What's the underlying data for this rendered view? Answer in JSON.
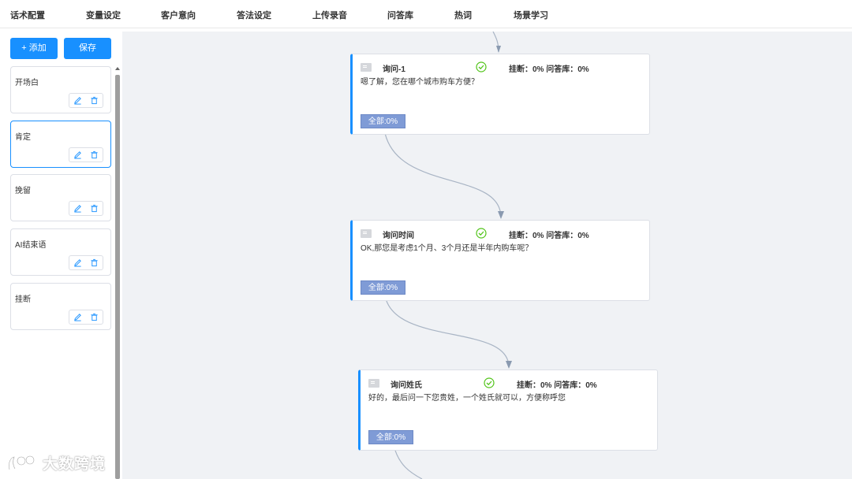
{
  "topnav": {
    "tabs": [
      "话术配置",
      "变量设定",
      "客户意向",
      "答法设定",
      "上传录音",
      "问答库",
      "热词",
      "场景学习"
    ]
  },
  "sidebar": {
    "add_label": "+ 添加",
    "save_label": "保存",
    "nodes": [
      {
        "label": "开场白",
        "active": false
      },
      {
        "label": "肯定",
        "active": true
      },
      {
        "label": "挽留",
        "active": false
      },
      {
        "label": "AI结束语",
        "active": false
      },
      {
        "label": "挂断",
        "active": false
      }
    ]
  },
  "flow": {
    "cards": [
      {
        "title": "询问-1",
        "stats": "挂断：0%  问答库：0%",
        "text": "嗯了解，您在哪个城市购车方便？",
        "branch": "全部:0%"
      },
      {
        "title": "询问时间",
        "stats": "挂断：0%  问答库：0%",
        "text": "OK,那您是考虑1个月、3个月还是半年内购车呢？",
        "branch": "全部:0%"
      },
      {
        "title": "询问姓氏",
        "stats": "挂断：0%  问答库：0%",
        "text": "好的，最后问一下您贵姓，一个姓氏就可以，方便称呼您",
        "branch": "全部:0%"
      }
    ]
  },
  "watermark": {
    "text": "大数跨境"
  },
  "colors": {
    "primary": "#1890ff",
    "canvas_bg": "#f0f2f5",
    "branch": "#7f9bd6",
    "check": "#52c41a"
  }
}
